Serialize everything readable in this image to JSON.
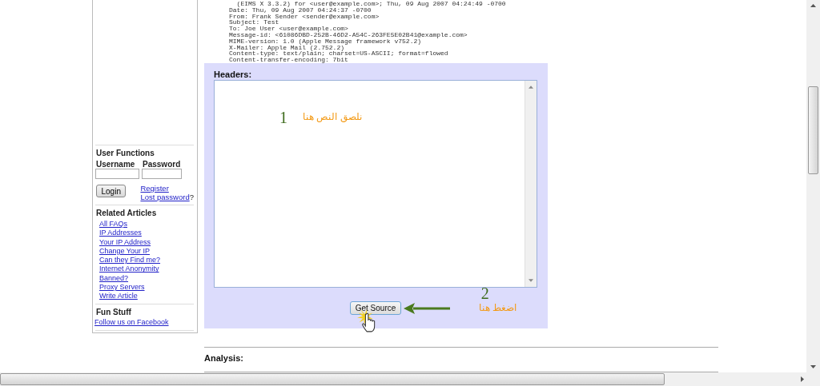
{
  "email_headers": [
    "  (EIMS X 3.3.2) for <user@example.com>; Thu, 09 Aug 2007 04:24:49 -0700",
    "Date: Thu, 09 Aug 2007 04:24:37 -0700",
    "From: Frank Sender <sender@example.com>",
    "Subject: Test",
    "To: Joe User <user@example.com>",
    "Message-id: <61086DBD-252B-46D2-A54C-263FE5E02B41@example.com>",
    "MIME-version: 1.0 (Apple Message framework v752.2)",
    "X-Mailer: Apple Mail (2.752.2)",
    "Content-type: text/plain; charset=US-ASCII; format=flowed",
    "Content-transfer-encoding: 7bit"
  ],
  "sidebar": {
    "user_functions": {
      "title": "User Functions",
      "username_label": "Username",
      "password_label": "Password",
      "login_button": "Login",
      "register_link": "Register",
      "lost_password_link": "Lost password",
      "lost_password_suffix": "?"
    },
    "related_articles": {
      "title": "Related Articles",
      "links": [
        "All FAQs",
        "IP Addresses",
        "Your IP Address",
        "Change Your IP",
        "Can they Find me?",
        "Internet Anonymity",
        "Banned?",
        "Proxy Servers",
        "Write Article"
      ]
    },
    "fun_stuff": {
      "title": "Fun Stuff",
      "links": [
        "Follow us on Facebook"
      ]
    }
  },
  "headers_form": {
    "label": "Headers:",
    "annotation_number": "1",
    "annotation_text": "نلصق النص هنا",
    "button": "Get Source",
    "step_number": "2",
    "step_text": "اضغط هنا"
  },
  "analysis": {
    "label": "Analysis:"
  }
}
